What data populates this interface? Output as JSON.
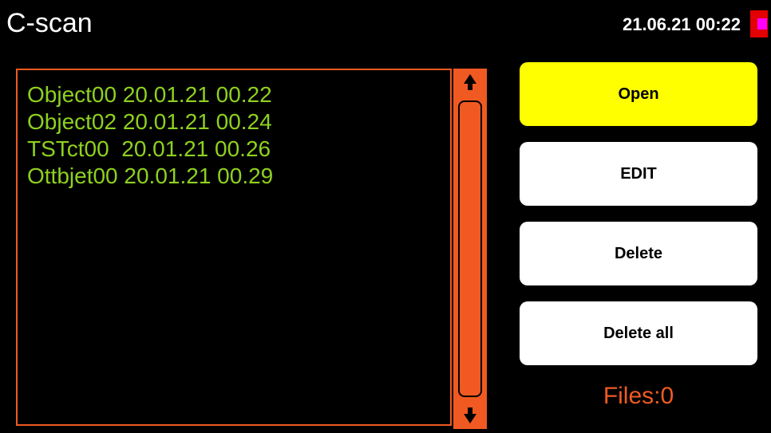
{
  "header": {
    "title": "C-scan",
    "datetime": "21.06.21  00:22",
    "battery_icon": "battery-icon"
  },
  "file_list": {
    "items": [
      "Object00 20.01.21 00.22",
      "Object02 20.01.21 00.24",
      "TSTct00  20.01.21 00.26",
      "Ottbjet00 20.01.21 00.29"
    ]
  },
  "scrollbar": {
    "up_icon": "arrow-up-icon",
    "down_icon": "arrow-down-icon"
  },
  "buttons": {
    "open": "Open",
    "edit": "EDIT",
    "delete": "Delete",
    "delete_all": "Delete all"
  },
  "status": {
    "files": "Files:0"
  },
  "colors": {
    "background": "#000000",
    "accent": "#f05a22",
    "list_text": "#8ed11f",
    "selected_button": "#ffff00",
    "button": "#ffffff",
    "battery": "#e30000",
    "battery_level": "#ff00ff"
  }
}
